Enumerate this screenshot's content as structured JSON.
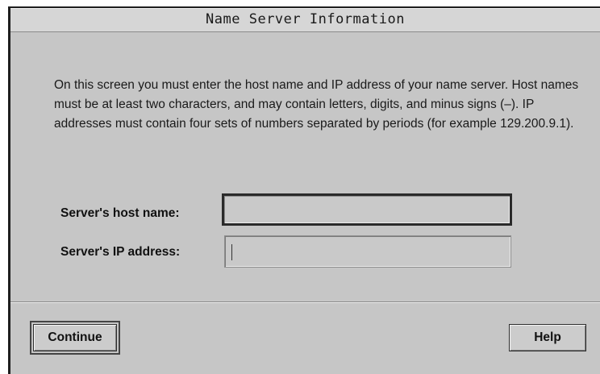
{
  "window": {
    "title": "Name Server Information"
  },
  "instructions": "On this screen you must enter the host name and IP address of your name server.  Host names must be at least two characters, and may contain letters, digits, and minus signs (–).  IP addresses must contain four sets of numbers separated by periods (for example 129.200.9.1).",
  "form": {
    "host_label": "Server's host name:",
    "host_value": "",
    "ip_label": "Server's IP address:",
    "ip_value": ""
  },
  "buttons": {
    "continue_label": "Continue",
    "help_label": "Help"
  }
}
